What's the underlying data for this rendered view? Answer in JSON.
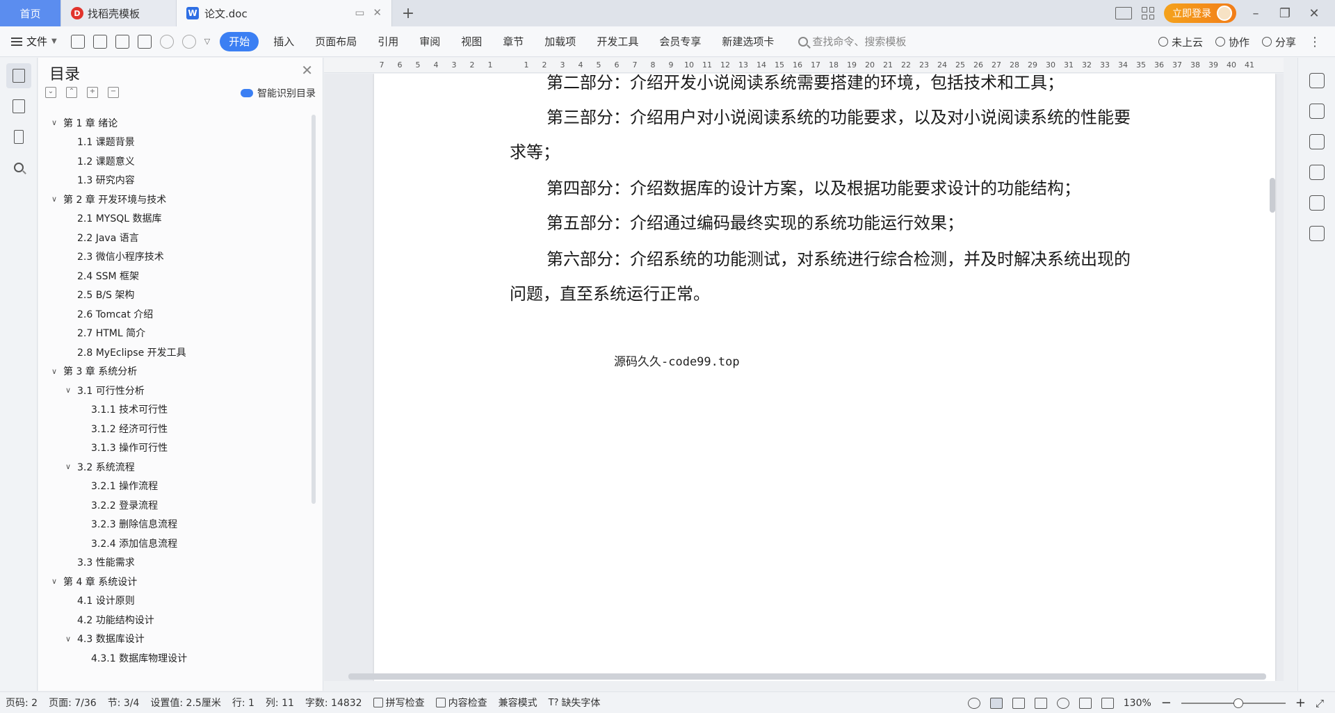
{
  "tabs": {
    "home": "首页",
    "template": "找稻壳模板",
    "doc": "论文.doc",
    "add": "+"
  },
  "window": {
    "login": "立即登录",
    "minimize": "–",
    "restore": "❐",
    "close": "✕"
  },
  "toolbar": {
    "file": "文件",
    "ribbon": [
      "开始",
      "插入",
      "页面布局",
      "引用",
      "审阅",
      "视图",
      "章节",
      "加载项",
      "开发工具",
      "会员专享",
      "新建选项卡"
    ],
    "search_placeholder": "查找命令、搜索模板",
    "cloud": "未上云",
    "collab": "协作",
    "share": "分享"
  },
  "toc": {
    "title": "目录",
    "smart": "智能识别目录",
    "items": [
      {
        "level": 1,
        "chev": "v",
        "text": "第 1 章  绪论"
      },
      {
        "level": 2,
        "text": "1.1  课题背景"
      },
      {
        "level": 2,
        "text": "1.2  课题意义"
      },
      {
        "level": 2,
        "text": "1.3  研究内容"
      },
      {
        "level": 1,
        "chev": "v",
        "text": "第 2 章  开发环境与技术"
      },
      {
        "level": 2,
        "text": "2.1  MYSQL 数据库"
      },
      {
        "level": 2,
        "text": "2.2 Java 语言"
      },
      {
        "level": 2,
        "text": "2.3  微信小程序技术"
      },
      {
        "level": 2,
        "text": "2.4 SSM 框架"
      },
      {
        "level": 2,
        "text": "2.5 B/S 架构"
      },
      {
        "level": 2,
        "text": "2.6 Tomcat  介绍"
      },
      {
        "level": 2,
        "text": "2.7 HTML 简介"
      },
      {
        "level": 2,
        "text": "2.8 MyEclipse 开发工具"
      },
      {
        "level": 1,
        "chev": "v",
        "text": "第 3 章  系统分析"
      },
      {
        "level": 2,
        "chev": "v",
        "text": "3.1  可行性分析"
      },
      {
        "level": 3,
        "text": "3.1.1  技术可行性"
      },
      {
        "level": 3,
        "text": "3.1.2  经济可行性"
      },
      {
        "level": 3,
        "text": "3.1.3  操作可行性"
      },
      {
        "level": 2,
        "chev": "v",
        "text": "3.2  系统流程"
      },
      {
        "level": 3,
        "text": "3.2.1  操作流程"
      },
      {
        "level": 3,
        "text": "3.2.2  登录流程"
      },
      {
        "level": 3,
        "text": "3.2.3  删除信息流程"
      },
      {
        "level": 3,
        "text": "3.2.4  添加信息流程"
      },
      {
        "level": 2,
        "text": "3.3  性能需求"
      },
      {
        "level": 1,
        "chev": "v",
        "text": "第 4 章  系统设计"
      },
      {
        "level": 2,
        "text": "4.1  设计原则"
      },
      {
        "level": 2,
        "text": "4.2  功能结构设计"
      },
      {
        "level": 2,
        "chev": "v",
        "text": "4.3  数据库设计"
      },
      {
        "level": 3,
        "text": "4.3.1  数据库物理设计"
      }
    ]
  },
  "ruler": [
    "7",
    "6",
    "5",
    "4",
    "3",
    "2",
    "1",
    "",
    "1",
    "2",
    "3",
    "4",
    "5",
    "6",
    "7",
    "8",
    "9",
    "10",
    "11",
    "12",
    "13",
    "14",
    "15",
    "16",
    "17",
    "18",
    "19",
    "20",
    "21",
    "22",
    "23",
    "24",
    "25",
    "26",
    "27",
    "28",
    "29",
    "30",
    "31",
    "32",
    "33",
    "34",
    "35",
    "36",
    "37",
    "38",
    "39",
    "40",
    "41"
  ],
  "document": {
    "paragraphs": [
      "第二部分：介绍开发小说阅读系统需要搭建的环境，包括技术和工具；",
      "第三部分：介绍用户对小说阅读系统的功能要求，以及对小说阅读系统的性能要求等；",
      "第四部分：介绍数据库的设计方案，以及根据功能要求设计的功能结构；",
      "第五部分：介绍通过编码最终实现的系统功能运行效果；",
      "第六部分：介绍系统的功能测试，对系统进行综合检测，并及时解决系统出现的问题，直至系统运行正常。"
    ],
    "watermark": "源码久久-code99.top"
  },
  "status": {
    "page_code": "页码: 2",
    "page": "页面: 7/36",
    "section": "节: 3/4",
    "setting": "设置值: 2.5厘米",
    "row": "行: 1",
    "col": "列: 11",
    "words": "字数: 14832",
    "spell": "拼写检查",
    "content_check": "内容检查",
    "compat": "兼容模式",
    "missing_font": "缺失字体",
    "zoom": "130%",
    "zoom_level": 0.55
  }
}
